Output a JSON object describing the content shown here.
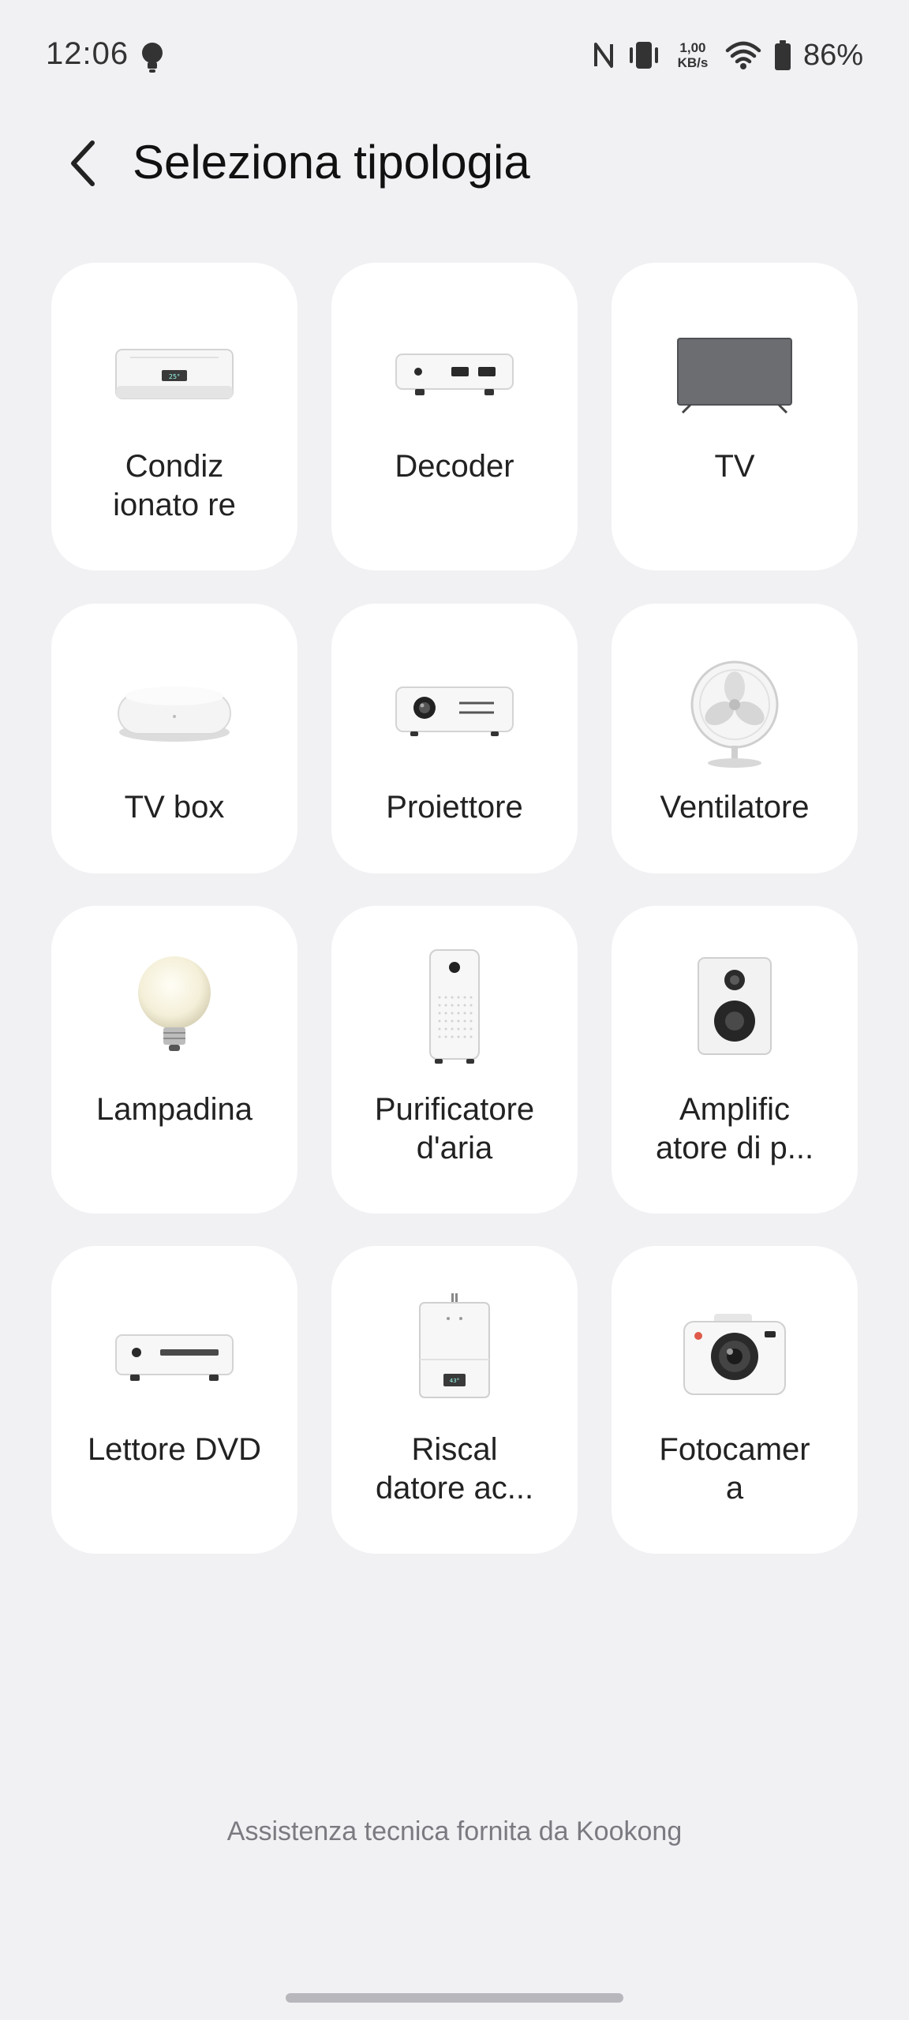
{
  "status_bar": {
    "time": "12:06",
    "network_speed_value": "1,00",
    "network_speed_unit": "KB/s",
    "battery_percent": "86%",
    "icons": [
      "bulb-icon",
      "nfc-icon",
      "vibrate-icon",
      "wifi-icon",
      "battery-icon"
    ]
  },
  "header": {
    "back_icon": "chevron-left-icon",
    "title": "Seleziona tipologia"
  },
  "device_types": [
    {
      "label": "Condiz\nionato re",
      "icon": "air-conditioner-icon"
    },
    {
      "label": "Decoder",
      "icon": "decoder-icon"
    },
    {
      "label": "TV",
      "icon": "tv-icon"
    },
    {
      "label": "TV box",
      "icon": "tv-box-icon"
    },
    {
      "label": "Proiettore",
      "icon": "projector-icon"
    },
    {
      "label": "Ventilatore",
      "icon": "fan-icon"
    },
    {
      "label": "Lampadina",
      "icon": "light-bulb-icon"
    },
    {
      "label": "Purificatore\nd'aria",
      "icon": "air-purifier-icon"
    },
    {
      "label": "Amplific\natore di p...",
      "icon": "speaker-icon"
    },
    {
      "label": "Lettore DVD",
      "icon": "dvd-player-icon"
    },
    {
      "label": "Riscal\ndatore ac...",
      "icon": "water-heater-icon"
    },
    {
      "label": "Fotocamer\na",
      "icon": "camera-icon"
    }
  ],
  "footer": {
    "text": "Assistenza tecnica fornita da Kookong"
  },
  "colors": {
    "background": "#f1f1f4",
    "card": "#ffffff",
    "footer_text": "#7a7a80"
  }
}
